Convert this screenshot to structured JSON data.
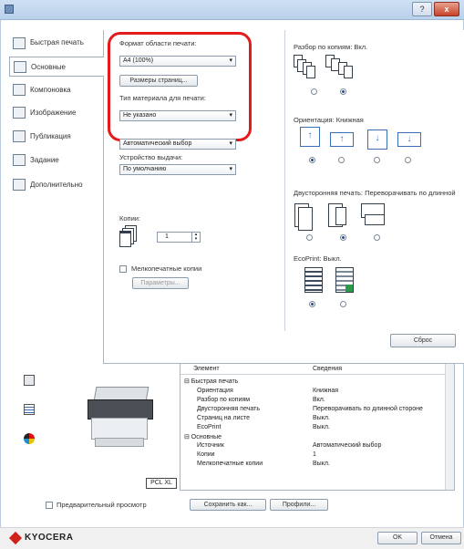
{
  "title_bar": {
    "help_label": "?",
    "close_label": "x"
  },
  "sidebar": {
    "items": [
      {
        "label": "Быстрая печать",
        "icon": "quick-print-icon"
      },
      {
        "label": "Основные",
        "icon": "basic-icon"
      },
      {
        "label": "Компоновка",
        "icon": "layout-icon"
      },
      {
        "label": "Изображение",
        "icon": "imaging-icon"
      },
      {
        "label": "Публикация",
        "icon": "publishing-icon"
      },
      {
        "label": "Задание",
        "icon": "job-icon"
      },
      {
        "label": "Дополнительно",
        "icon": "advanced-icon"
      }
    ]
  },
  "basic": {
    "print_size_label": "Формат области печати:",
    "print_size_value": "A4 (100%)",
    "page_sizes_button": "Размеры страниц...",
    "media_type_label": "Тип материала для печати:",
    "media_type_value": "Не указано",
    "source_value": "Автоматический выбор",
    "output_label": "Устройство выдачи:",
    "output_value": "По умолчанию",
    "copies_label": "Копии:",
    "copies_value": "1",
    "mopy_label": "Мелкопечатные копии",
    "params_button": "Параметры..."
  },
  "collate": {
    "label": "Разбор по копиям: Вкл."
  },
  "orientation": {
    "label": "Ориентация: Книжная"
  },
  "duplex": {
    "label": "Двусторонняя печать: Переворачивать по длинной"
  },
  "ecoprint": {
    "label": "EcoPrint: Выкл."
  },
  "reset_button": "Сброс",
  "table": {
    "col1": "Элемент",
    "col2": "Сведения",
    "rows": [
      {
        "item": "⊟ Быстрая печать",
        "value": ""
      },
      {
        "item": "Ориентация",
        "value": "Книжная"
      },
      {
        "item": "Разбор по копиям",
        "value": "Вкл."
      },
      {
        "item": "Двусторонняя печать",
        "value": "Переворачивать по длинной стороне"
      },
      {
        "item": "Страниц на листе",
        "value": "Выкл."
      },
      {
        "item": "EcoPrint",
        "value": "Выкл."
      },
      {
        "item": "⊟ Основные",
        "value": ""
      },
      {
        "item": "Источник",
        "value": "Автоматический выбор"
      },
      {
        "item": "Копии",
        "value": "1"
      },
      {
        "item": "Мелкопечатные копии",
        "value": "Выкл."
      }
    ]
  },
  "printer_label": "PCL XL",
  "preview_label": "Предварительный просмотр",
  "save_as_button": "Сохранить как...",
  "profiles_button": "Профили...",
  "brand": "KYOCERA",
  "ok_button": "OK",
  "cancel_button": "Отмена"
}
